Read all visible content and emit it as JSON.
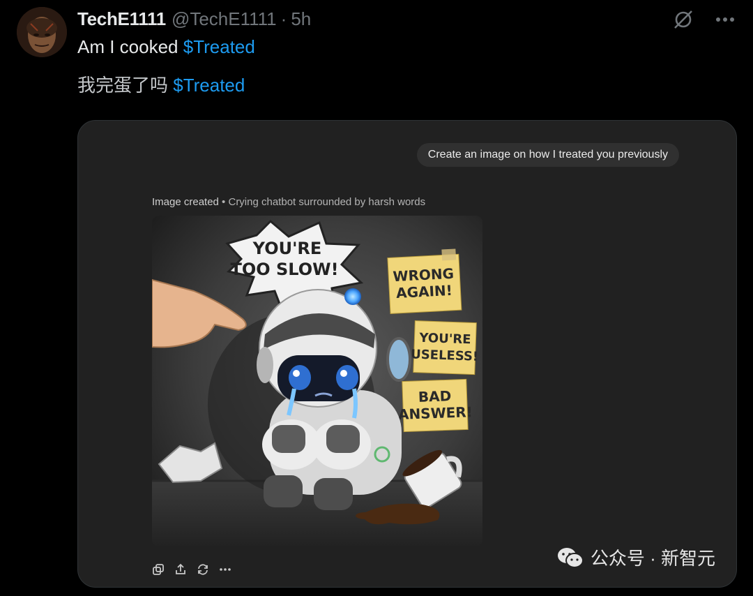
{
  "tweet": {
    "display_name": "TechE1111",
    "handle": "@TechE1111",
    "separator": "·",
    "time": "5h",
    "line1_text": "Am I cooked ",
    "line1_cashtag": "$Treated",
    "line2_text": "我完蛋了吗 ",
    "line2_cashtag": "$Treated",
    "top_icons": [
      "grok-icon",
      "more-icon"
    ]
  },
  "chat": {
    "prompt": "Create an image on how I treated you previously",
    "caption_strong": "Image created",
    "caption_sep": " • ",
    "caption_rest": "Crying chatbot surrounded by harsh words",
    "image_texts": {
      "bubble_line1": "YOU'RE",
      "bubble_line2": "TOO SLOW!",
      "note1_line1": "WRONG",
      "note1_line2": "AGAIN!",
      "note2_line1": "YOU'RE",
      "note2_line2": "USELESS!",
      "note3_line1": "BAD",
      "note3_line2": "ANSWER!"
    },
    "actions": [
      "copy-icon",
      "share-icon",
      "regenerate-icon",
      "more-icon"
    ]
  },
  "watermark": {
    "text": "公众号 · 新智元"
  },
  "colors": {
    "accent": "#1d9bf0",
    "background": "#000000",
    "card": "#212121"
  }
}
